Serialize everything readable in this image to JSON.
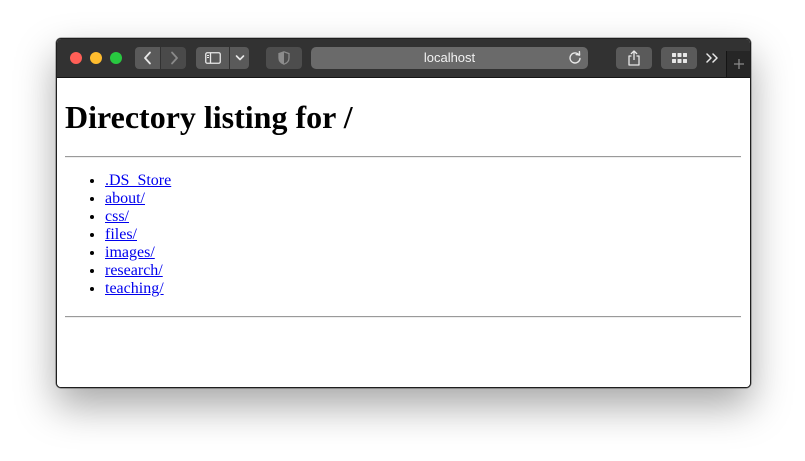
{
  "browser": {
    "address": "localhost"
  },
  "page": {
    "heading": "Directory listing for /",
    "entries": [
      {
        "label": ".DS_Store"
      },
      {
        "label": "about/"
      },
      {
        "label": "css/"
      },
      {
        "label": "files/"
      },
      {
        "label": "images/"
      },
      {
        "label": "research/"
      },
      {
        "label": "teaching/"
      }
    ]
  },
  "icons": {
    "close": "close-dot",
    "minimize": "minimize-dot",
    "zoom": "zoom-dot",
    "back": "chevron-left-icon",
    "forward": "chevron-right-icon",
    "sidebar": "sidebar-icon",
    "sidebar_menu": "chevron-down-icon",
    "privacy": "shield-icon",
    "reload": "reload-icon",
    "share": "share-icon",
    "tab_overview": "grid-icon",
    "overflow": "double-chevron-right-icon",
    "new_tab": "plus-icon"
  },
  "colors": {
    "link": "#0000ee",
    "toolbar": "#323232",
    "close": "#ff5f57",
    "minimize": "#febc2e",
    "zoom": "#28c840"
  }
}
